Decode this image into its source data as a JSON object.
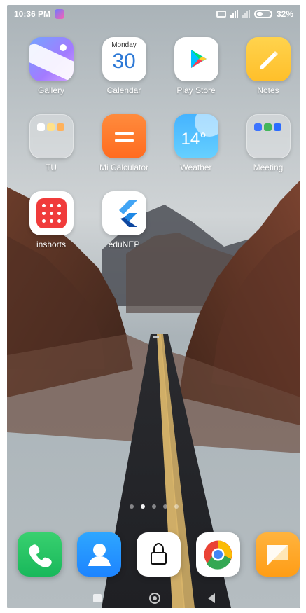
{
  "status_bar": {
    "time": "10:36 PM",
    "battery": "32%"
  },
  "home": {
    "apps": [
      {
        "label": "Gallery",
        "icon": "gallery-icon"
      },
      {
        "label": "Calendar",
        "icon": "calendar-icon",
        "calendar_month": "Monday",
        "calendar_day": "30"
      },
      {
        "label": "Play Store",
        "icon": "play-store-icon"
      },
      {
        "label": "Notes",
        "icon": "notes-icon"
      },
      {
        "label": "TU",
        "icon": "folder-icon"
      },
      {
        "label": "Mi Calculator",
        "icon": "calculator-icon"
      },
      {
        "label": "Weather",
        "icon": "weather-icon",
        "temperature": "14°"
      },
      {
        "label": "Meeting",
        "icon": "folder-icon"
      },
      {
        "label": "inshorts",
        "icon": "inshorts-icon"
      },
      {
        "label": "eduNEP",
        "icon": "flutter-icon"
      }
    ],
    "page_indicators": {
      "count": 5,
      "active_index": 1
    }
  },
  "dock": {
    "apps": [
      {
        "icon": "phone-icon"
      },
      {
        "icon": "contacts-icon"
      },
      {
        "icon": "lock-icon"
      },
      {
        "icon": "chrome-icon"
      },
      {
        "icon": "messages-icon"
      }
    ]
  },
  "nav": {
    "recent_icon": "square-icon",
    "home_icon": "circle-icon",
    "back_icon": "back-triangle-icon"
  }
}
